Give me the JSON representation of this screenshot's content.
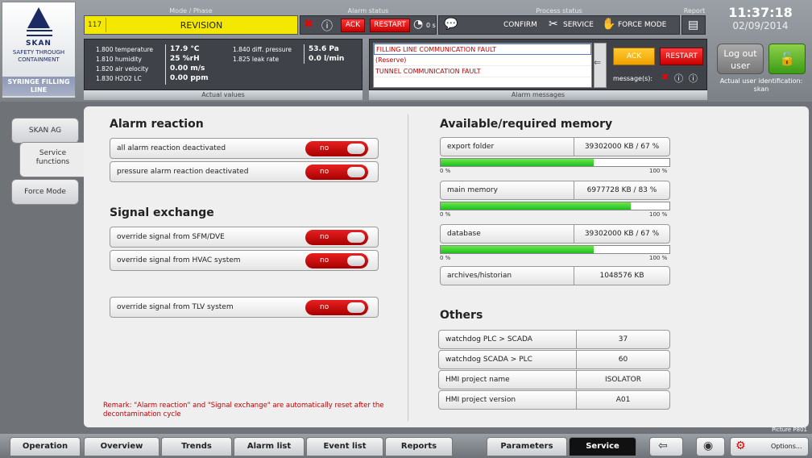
{
  "logo": {
    "brand": "SKAN",
    "tagline": "SAFETY THROUGH CONTAINMENT",
    "line_name": "SYRINGE FILLING LINE"
  },
  "header": {
    "mode_label": "Mode / Phase",
    "mode_number": "117",
    "mode_name": "REVISION",
    "alarm_label": "Alarm status",
    "ack": "ACK",
    "restart": "RESTART",
    "timer": "0 s",
    "process_label": "Process status",
    "confirm": "CONFIRM",
    "service": "SERVICE",
    "force_mode": "FORCE MODE",
    "report_label": "Report"
  },
  "actual_values": {
    "title": "Actual values",
    "rows": [
      {
        "label": "1.800 temperature",
        "value": "17.9 °C"
      },
      {
        "label": "1.810 humidity",
        "value": "25 %rH"
      },
      {
        "label": "1.820 air velocity",
        "value": "0.00 m/s"
      },
      {
        "label": "1.830 H2O2 LC",
        "value": "0.00 ppm"
      }
    ],
    "rows2": [
      {
        "label": "1.840 diff. pressure",
        "value": "53.6 Pa"
      },
      {
        "label": "1.825 leak rate",
        "value": "0.0 l/min"
      }
    ]
  },
  "alarm_messages": {
    "title": "Alarm messages",
    "items": [
      "FILLING LINE COMMUNICATION FAULT",
      "(Reserve)",
      "TUNNEL COMMUNICATION FAULT"
    ],
    "ack": "ACK",
    "restart": "RESTART",
    "messages_label": "message(s):"
  },
  "clock": {
    "time": "11:37:18",
    "date": "02/09/2014"
  },
  "user": {
    "logout": "Log out user",
    "id_label": "Actual user identification:",
    "id_value": "skan"
  },
  "side": {
    "items": [
      "SKAN AG",
      "Service functions",
      "Force Mode"
    ]
  },
  "alarm_reaction": {
    "title": "Alarm reaction",
    "items": [
      {
        "label": "all alarm reaction deactivated",
        "state": "no"
      },
      {
        "label": "pressure alarm reaction deactivated",
        "state": "no"
      }
    ]
  },
  "signal_exchange": {
    "title": "Signal exchange",
    "items": [
      {
        "label": "override signal from SFM/DVE",
        "state": "no"
      },
      {
        "label": "override signal from HVAC system",
        "state": "no"
      },
      {
        "label": "override signal from TLV system",
        "state": "no"
      }
    ]
  },
  "remark": "Remark: \"Alarm reaction\" and \"Signal exchange\" are automatically reset after the decontamination cycle",
  "memory": {
    "title": "Available/required memory",
    "items": [
      {
        "label": "export folder",
        "value": "39302000 KB / 67 %",
        "percent": 67,
        "min": "0 %",
        "max": "100 %"
      },
      {
        "label": "main memory",
        "value": "6977728 KB / 83 %",
        "percent": 83,
        "min": "0 %",
        "max": "100 %"
      },
      {
        "label": "database",
        "value": "39302000 KB / 67 %",
        "percent": 67,
        "min": "0 %",
        "max": "100 %"
      }
    ],
    "archives": {
      "label": "archives/historian",
      "value": "1048576 KB"
    }
  },
  "others": {
    "title": "Others",
    "items": [
      {
        "label": "watchdog PLC > SCADA",
        "value": "37"
      },
      {
        "label": "watchdog SCADA > PLC",
        "value": "60"
      },
      {
        "label": "HMI project name",
        "value": "ISOLATOR"
      },
      {
        "label": "HMI project version",
        "value": "A01"
      }
    ]
  },
  "picture_id": "Picture P801",
  "bottom_tabs": [
    "Operation",
    "Overview",
    "Trends",
    "Alarm list",
    "Event list",
    "Reports",
    "Parameters",
    "Service"
  ],
  "active_tab": "Service",
  "options": "Options..."
}
